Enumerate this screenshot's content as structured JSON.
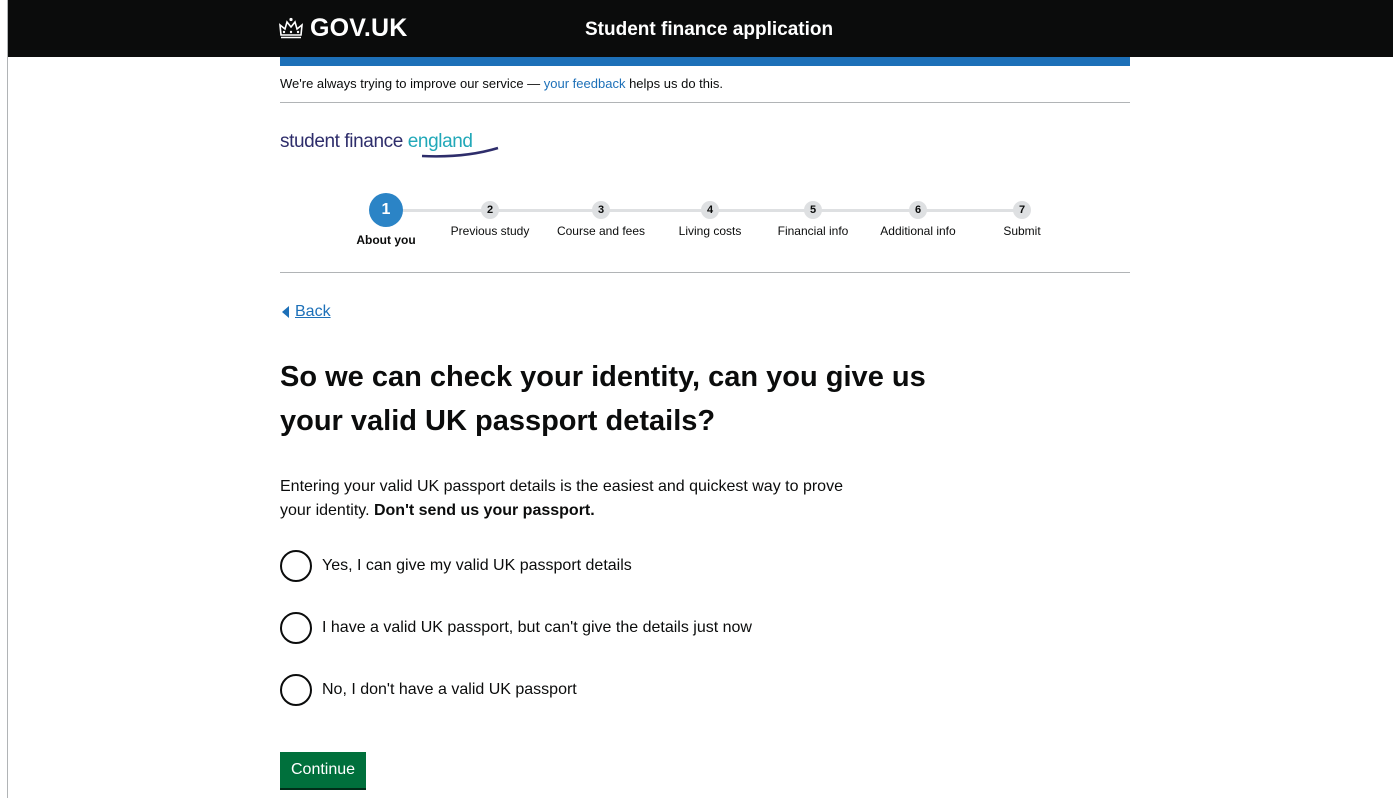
{
  "header": {
    "logo_text": "GOV.UK",
    "service_name": "Student finance application"
  },
  "phase_banner": {
    "text_before": "We're always trying to improve our service — ",
    "link_text": "your feedback",
    "text_after": " helps us do this."
  },
  "brand": {
    "part1": "student finance ",
    "part2": "england"
  },
  "stepper": {
    "current_step": 1,
    "steps": [
      {
        "number": "1",
        "label": "About you"
      },
      {
        "number": "2",
        "label": "Previous study"
      },
      {
        "number": "3",
        "label": "Course and fees"
      },
      {
        "number": "4",
        "label": "Living costs"
      },
      {
        "number": "5",
        "label": "Financial info"
      },
      {
        "number": "6",
        "label": "Additional info"
      },
      {
        "number": "7",
        "label": "Submit"
      }
    ]
  },
  "back_link": "Back",
  "page_title": "So we can check your identity, can you give us your valid UK passport details?",
  "lead": {
    "text": "Entering your valid UK passport details is the easiest and quickest way to prove your identity. ",
    "bold": "Don't send us your passport."
  },
  "options": [
    {
      "label": "Yes, I can give my valid UK passport details",
      "selected": false
    },
    {
      "label": "I have a valid UK passport, but can't give the details just now",
      "selected": false
    },
    {
      "label": "No, I don't have a valid UK passport",
      "selected": false
    }
  ],
  "continue_label": "Continue",
  "colors": {
    "header_bg": "#0b0c0c",
    "blue_bar": "#1d70b8",
    "link": "#1d70b8",
    "active_step": "#2b84c6",
    "button": "#00703c"
  },
  "icons": {
    "crown": "crown-icon",
    "back": "triangle-left-icon"
  }
}
